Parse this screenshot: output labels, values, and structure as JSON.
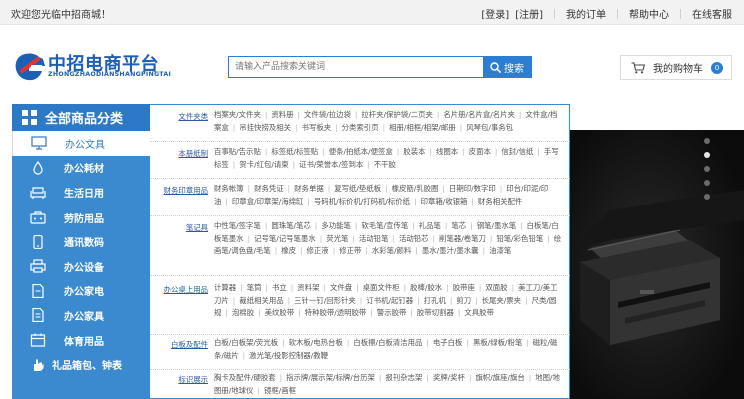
{
  "topbar": {
    "welcome": "欢迎您光临中招商城！",
    "links": [
      "[登录]",
      "[注册]",
      "我的订单",
      "帮助中心",
      "在线客服"
    ]
  },
  "logo": {
    "name": "中招电商平台",
    "subtitle": "ZHONGZHAODIANSHANGPINGTAI"
  },
  "search": {
    "placeholder": "请输入产品搜索关键词",
    "button": "搜索"
  },
  "cart": {
    "label": "我的购物车",
    "count": "0"
  },
  "categories": {
    "header": "全部商品分类",
    "items": [
      {
        "label": "办公文具",
        "icon": "monitor-icon"
      },
      {
        "label": "办公耗材",
        "icon": "ink-drop-icon"
      },
      {
        "label": "生活日用",
        "icon": "armchair-icon"
      },
      {
        "label": "劳防用品",
        "icon": "toolbox-icon"
      },
      {
        "label": "通讯数码",
        "icon": "phone-icon"
      },
      {
        "label": "办公设备",
        "icon": "printer-icon"
      },
      {
        "label": "办公家电",
        "icon": "file-icon"
      },
      {
        "label": "办公家具",
        "icon": "document-icon"
      },
      {
        "label": "体育用品",
        "icon": "calendar-icon"
      },
      {
        "label": "礼品箱包、钟表",
        "icon": "hand-icon"
      }
    ]
  },
  "subcategories": [
    {
      "title": "文件夹类",
      "links": [
        "档案夹/文件夹",
        "资料册",
        "文件袋/拉边袋",
        "拉杆夹/保护袋/二页夹",
        "名片册/名片盒/名片夹",
        "文件盒/档案盒",
        "吊挂快捞及相关",
        "书写板夹",
        "分类索引页",
        "相册/相框/相架/邮册",
        "风琴包/事务包"
      ]
    },
    {
      "title": "本册纸制",
      "links": [
        "百事贴/告示贴",
        "标签纸/标签贴",
        "便条/拍纸本/便签盒",
        "胶装本",
        "线圈本",
        "皮面本",
        "信封/信纸",
        "手写标签",
        "贺卡/红包/请柬",
        "证书/荣誉本/签到本",
        "不干胶"
      ]
    },
    {
      "title": "财务印章用品",
      "links": [
        "财务帐簿",
        "财务凭证",
        "财务单据",
        "复写纸/垫纸板",
        "橡皮筋/乳胶圈",
        "日期印/数字印",
        "印台/印泥/印油",
        "印章盒/印章架/海绵缸",
        "号码机/标价机/打码机/标价纸",
        "印章箱/收银箱",
        "财务相关配件"
      ]
    },
    {
      "title": "笔记具",
      "links": [
        "中性笔/签字笔",
        "圆珠笔/笔芯",
        "多功能笔",
        "软毛笔/宣传笔",
        "礼品笔",
        "笔芯",
        "钢笔/墨水笔",
        "白板笔/白板笔墨水",
        "记号笔/记号笔墨水",
        "荧光笔",
        "活动铅笔",
        "活动铅芯",
        "削笔器/卷笔刀",
        "铅笔/彩色铅笔",
        "绘画笔/调色盘/毛笔",
        "橡皮",
        "修正液",
        "修正带",
        "水彩笔/颜料",
        "墨水/墨汁/墨水囊",
        "油漆笔"
      ]
    },
    {
      "title": "办公桌上用品",
      "links": [
        "计算器",
        "笔筒",
        "书立",
        "资料架",
        "文件盘",
        "桌面文件柜",
        "胶棒/胶水",
        "胶带座",
        "双面胶",
        "美工刀/美工刀片",
        "裁纸相关用品",
        "三针一钉/回形针夹",
        "订书机/起钉器",
        "打孔机",
        "剪刀",
        "长尾夹/票夹",
        "尺类/圆规",
        "泡棉胶",
        "美纹胶带",
        "特种胶带/透明胶带",
        "警示胶带",
        "胶带切割器",
        "文具胶带"
      ]
    },
    {
      "title": "白板及配件",
      "links": [
        "白板/白板架/荧光板",
        "软木板/电热台板",
        "白板擦/白板清洁用品",
        "电子白板",
        "黑板/绿板/粉笔",
        "磁粒/磁条/磁片",
        "激光笔/投影控制器/教鞭"
      ]
    },
    {
      "title": "标识展示",
      "links": [
        "胸卡及配件/硬胶套",
        "指示牌/展示架/标牌/台历架",
        "报刊杂志架",
        "奖牌/奖杯",
        "旗帜/旗座/旗台",
        "地图/地图册/地球仪",
        "镜框/画框"
      ]
    }
  ],
  "banner": {
    "slide_count": 5,
    "active_slide": 2
  }
}
